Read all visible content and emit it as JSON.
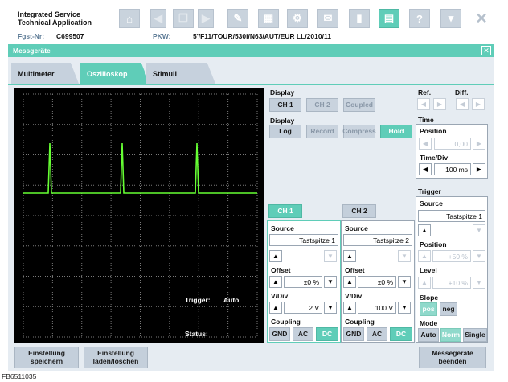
{
  "header": {
    "app_title_line1": "Integrated Service",
    "app_title_line2": "Technical Application",
    "fgst_label": "Fgst-Nr:",
    "fgst_value": "C699507",
    "pkw_label": "PKW:",
    "pkw_value": "5'/F11/TOUR/530i/N63/AUT/EUR LL/2010/11"
  },
  "toolbar": {
    "icons": [
      "home-icon",
      "arrow-left-icon",
      "copy-icon",
      "arrow-right-icon",
      "wrench-icon",
      "ecu-icon",
      "gear-icon",
      "mail-icon",
      "battery-icon",
      "measure-icon",
      "help-icon",
      "dropdown-icon",
      "close-icon"
    ]
  },
  "window": {
    "title": "Messgeräte",
    "close_glyph": "✕"
  },
  "tabs": [
    {
      "label": "Multimeter"
    },
    {
      "label": "Oszilloskop"
    },
    {
      "label": "Stimuli"
    }
  ],
  "scope": {
    "trigger_label": "Trigger:",
    "trigger_value": "Auto",
    "status_label": "Status:",
    "colors": {
      "background": "#000000",
      "grid": "#7a7a7a",
      "trace": "#66ff33"
    }
  },
  "display": {
    "label1": "Display",
    "ch1": "CH 1",
    "ch2": "CH 2",
    "coupled": "Coupled",
    "label2": "Display",
    "log": "Log",
    "record": "Record",
    "compress": "Compress",
    "hold": "Hold"
  },
  "ref": {
    "ref_label": "Ref.",
    "diff_label": "Diff."
  },
  "time": {
    "label": "Time",
    "position_label": "Position",
    "position_value": "0,00",
    "timediv_label": "Time/Div",
    "timediv_value": "100 ms"
  },
  "channel_tabs": {
    "ch1": "CH 1",
    "ch2": "CH 2"
  },
  "channel1": {
    "source_label": "Source",
    "source_value": "Tastspitze 1",
    "offset_label": "Offset",
    "offset_value": "±0 %",
    "vdiv_label": "V/Div",
    "vdiv_value": "2 V",
    "coupling_label": "Coupling",
    "gnd": "GND",
    "ac": "AC",
    "dc": "DC"
  },
  "channel2": {
    "source_label": "Source",
    "source_value": "Tastspitze 2",
    "offset_label": "Offset",
    "offset_value": "±0 %",
    "vdiv_label": "V/Div",
    "vdiv_value": "100 V",
    "coupling_label": "Coupling",
    "gnd": "GND",
    "ac": "AC",
    "dc": "DC"
  },
  "trigger": {
    "label": "Trigger",
    "source_label": "Source",
    "source_value": "Tastspitze 1",
    "position_label": "Position",
    "position_value": "+50 %",
    "level_label": "Level",
    "level_value": "+10 %",
    "slope_label": "Slope",
    "pos": "pos",
    "neg": "neg",
    "mode_label": "Mode",
    "auto": "Auto",
    "norm": "Norm",
    "single": "Single"
  },
  "footer": {
    "save_line1": "Einstellung",
    "save_line2": "speichern",
    "load_line1": "Einstellung",
    "load_line2": "laden/löschen",
    "end_line1": "Messegeräte",
    "end_line2": "beenden",
    "image_id": "FB6511035"
  },
  "glyphs": {
    "up": "▲",
    "down": "▼",
    "left": "◀",
    "right": "▶"
  }
}
